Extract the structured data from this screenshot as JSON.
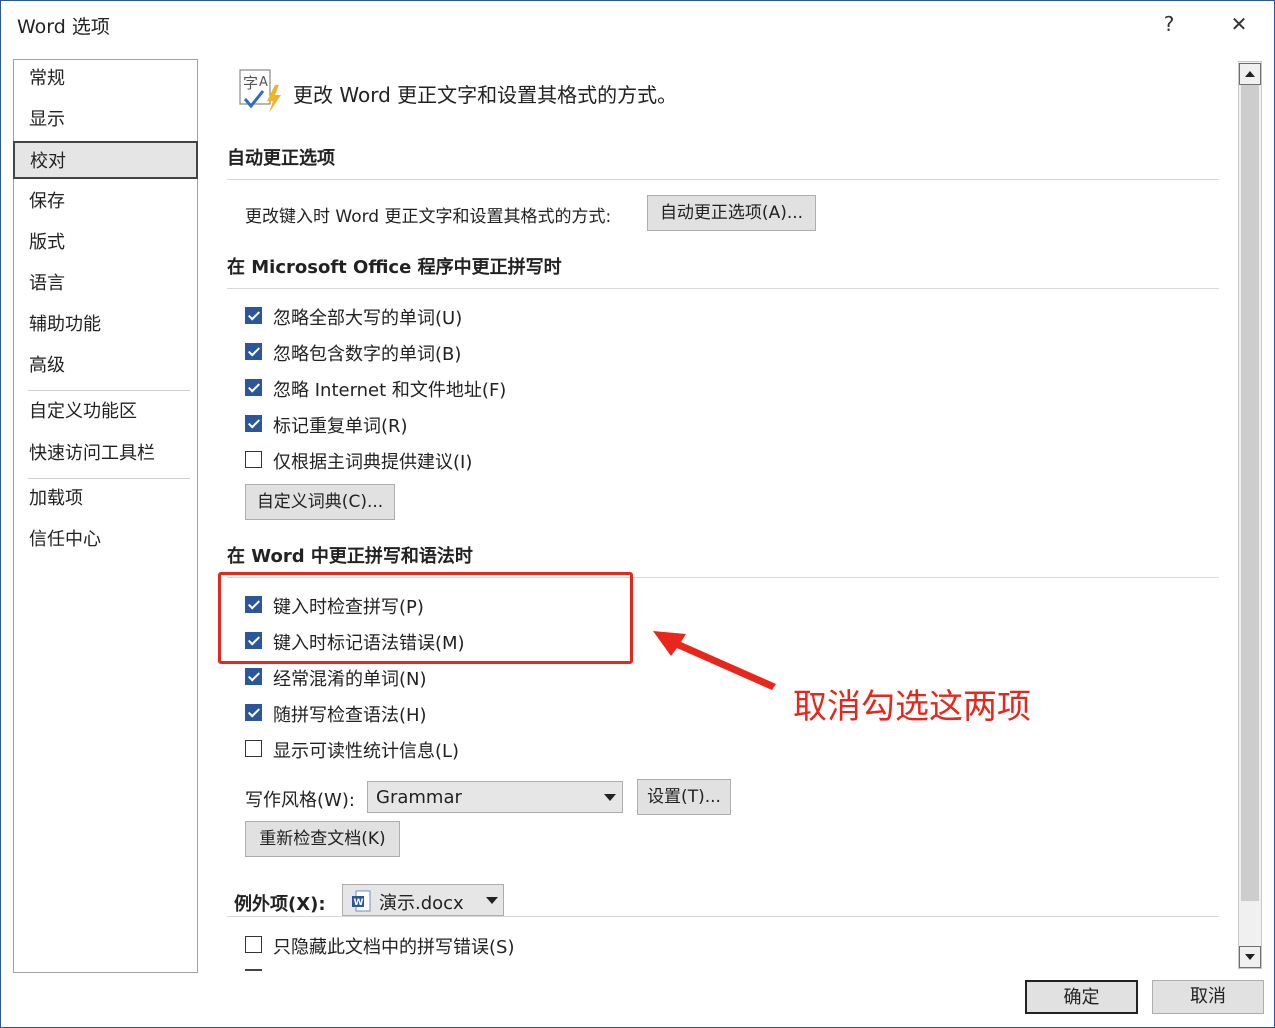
{
  "window": {
    "title": "Word 选项",
    "help_label": "?",
    "close_label": "✕"
  },
  "sidebar": {
    "items": [
      {
        "label": "常规"
      },
      {
        "label": "显示"
      },
      {
        "label": "校对"
      },
      {
        "label": "保存"
      },
      {
        "label": "版式"
      },
      {
        "label": "语言"
      },
      {
        "label": "辅助功能"
      },
      {
        "label": "高级"
      },
      {
        "label": "自定义功能区"
      },
      {
        "label": "快速访问工具栏"
      },
      {
        "label": "加载项"
      },
      {
        "label": "信任中心"
      }
    ],
    "selected": "校对"
  },
  "header": {
    "icon_text": "字A",
    "icon": "proofing-icon",
    "text": "更改 Word 更正文字和设置其格式的方式。"
  },
  "autocorrect": {
    "title": "自动更正选项",
    "desc": "更改键入时 Word 更正文字和设置其格式的方式:",
    "button": "自动更正选项(A)..."
  },
  "office_spelling": {
    "title": "在 Microsoft Office 程序中更正拼写时",
    "options": [
      {
        "label": "忽略全部大写的单词(U)",
        "checked": true
      },
      {
        "label": "忽略包含数字的单词(B)",
        "checked": true
      },
      {
        "label": "忽略 Internet 和文件地址(F)",
        "checked": true
      },
      {
        "label": "标记重复单词(R)",
        "checked": true
      },
      {
        "label": "仅根据主词典提供建议(I)",
        "checked": false
      }
    ],
    "custom_dict_button": "自定义词典(C)..."
  },
  "word_spelling": {
    "title": "在 Word 中更正拼写和语法时",
    "options": [
      {
        "label": "键入时检查拼写(P)",
        "checked": true
      },
      {
        "label": "键入时标记语法错误(M)",
        "checked": true
      },
      {
        "label": "经常混淆的单词(N)",
        "checked": true
      },
      {
        "label": "随拼写检查语法(H)",
        "checked": true
      },
      {
        "label": "显示可读性统计信息(L)",
        "checked": false
      }
    ],
    "writing_style_label": "写作风格(W):",
    "writing_style_value": "Grammar",
    "settings_button": "设置(T)...",
    "recheck_button": "重新检查文档(K)"
  },
  "exceptions": {
    "label": "例外项(X):",
    "file_value": "演示.docx",
    "file_icon": "word-doc-icon",
    "options": [
      {
        "label": "只隐藏此文档中的拼写错误(S)",
        "checked": false
      }
    ]
  },
  "annotation": {
    "text": "取消勾选这两项",
    "color": "#e8261c"
  },
  "footer": {
    "ok": "确定",
    "cancel": "取消"
  },
  "colors": {
    "accent": "#2b579a",
    "annotation": "#e8261c"
  }
}
